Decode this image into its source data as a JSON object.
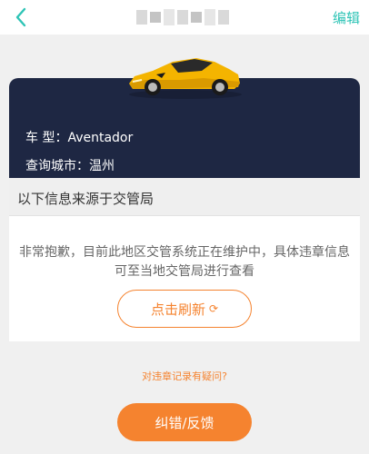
{
  "nav": {
    "back_icon": "chevron-left-icon",
    "edit_label": "编辑",
    "accent_color": "#2ec4b6"
  },
  "car": {
    "model_label": "车 型：",
    "model_value": "Aventador",
    "city_label": "查询城市：",
    "city_value": "温州",
    "card_color": "#1e2743",
    "car_color": "#f4b400"
  },
  "info": {
    "header": "以下信息来源于交管局",
    "message": "非常抱歉，目前此地区交管系统正在维护中，具体违章信息可至当地交管局进行查看",
    "refresh_label": "点击刷新",
    "refresh_icon": "refresh-icon"
  },
  "footer": {
    "question_link": "对违章记录有疑问?",
    "feedback_label": "纠错/反馈",
    "brand_color": "#f5832f"
  }
}
